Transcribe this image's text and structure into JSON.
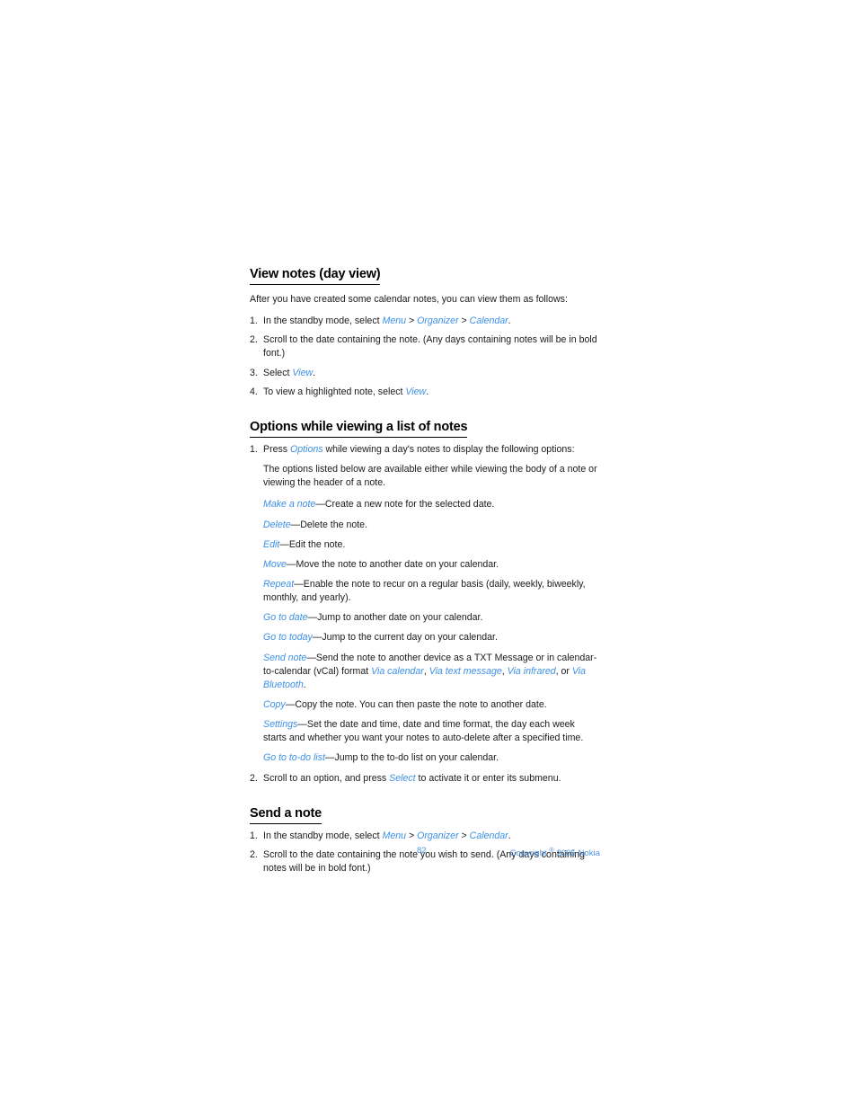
{
  "document": {
    "sections": [
      {
        "id": "view-notes",
        "heading": "View notes (day view)",
        "intro": "After you have created some calendar notes, you can view them as follows:",
        "steps": [
          {
            "num": "1.",
            "parts": [
              {
                "t": "text",
                "v": "In the standby mode, select "
              },
              {
                "t": "link",
                "v": "Menu"
              },
              {
                "t": "text",
                "v": " > "
              },
              {
                "t": "link",
                "v": "Organizer"
              },
              {
                "t": "text",
                "v": " > "
              },
              {
                "t": "link",
                "v": "Calendar"
              },
              {
                "t": "text",
                "v": "."
              }
            ]
          },
          {
            "num": "2.",
            "parts": [
              {
                "t": "text",
                "v": "Scroll to the date containing the note. (Any days containing notes will be in bold font.)"
              }
            ]
          },
          {
            "num": "3.",
            "parts": [
              {
                "t": "text",
                "v": "Select "
              },
              {
                "t": "link",
                "v": "View"
              },
              {
                "t": "text",
                "v": "."
              }
            ]
          },
          {
            "num": "4.",
            "parts": [
              {
                "t": "text",
                "v": "To view a highlighted note, select "
              },
              {
                "t": "link",
                "v": "View"
              },
              {
                "t": "text",
                "v": "."
              }
            ]
          }
        ]
      },
      {
        "id": "options-while-viewing",
        "heading": "Options while viewing a list of notes",
        "step1": {
          "num": "1.",
          "parts": [
            {
              "t": "text",
              "v": "Press "
            },
            {
              "t": "link",
              "v": "Options"
            },
            {
              "t": "text",
              "v": " while viewing a day's notes to display the following options:"
            }
          ]
        },
        "note_paragraph": "The options listed below are available either while viewing the body of a note or viewing the header of a note.",
        "options": [
          {
            "parts": [
              {
                "t": "link",
                "v": "Make a note"
              },
              {
                "t": "text",
                "v": "—Create a new note for the selected date."
              }
            ]
          },
          {
            "parts": [
              {
                "t": "link",
                "v": "Delete"
              },
              {
                "t": "text",
                "v": "—Delete the note."
              }
            ]
          },
          {
            "parts": [
              {
                "t": "link",
                "v": "Edit"
              },
              {
                "t": "text",
                "v": "—Edit the note."
              }
            ]
          },
          {
            "parts": [
              {
                "t": "link",
                "v": "Move"
              },
              {
                "t": "text",
                "v": "—Move the note to another date on your calendar."
              }
            ]
          },
          {
            "parts": [
              {
                "t": "link",
                "v": "Repeat"
              },
              {
                "t": "text",
                "v": "—Enable the note to recur on a regular basis (daily, weekly, biweekly, monthly, and yearly)."
              }
            ]
          },
          {
            "parts": [
              {
                "t": "link",
                "v": "Go to date"
              },
              {
                "t": "text",
                "v": "—Jump to another date on your calendar."
              }
            ]
          },
          {
            "parts": [
              {
                "t": "link",
                "v": "Go to today"
              },
              {
                "t": "text",
                "v": "—Jump to the current day on your calendar."
              }
            ]
          },
          {
            "parts": [
              {
                "t": "link",
                "v": "Send note"
              },
              {
                "t": "text",
                "v": "—Send the note to another device as a TXT Message or in calendar-to-calendar (vCal) format "
              },
              {
                "t": "link",
                "v": "Via calendar"
              },
              {
                "t": "text",
                "v": ", "
              },
              {
                "t": "link",
                "v": "Via text message"
              },
              {
                "t": "text",
                "v": ", "
              },
              {
                "t": "link",
                "v": "Via infrared"
              },
              {
                "t": "text",
                "v": ", or "
              },
              {
                "t": "link",
                "v": "Via Bluetooth"
              },
              {
                "t": "text",
                "v": "."
              }
            ]
          },
          {
            "parts": [
              {
                "t": "link",
                "v": "Copy"
              },
              {
                "t": "text",
                "v": "—Copy the note. You can then paste the note to another date."
              }
            ]
          },
          {
            "parts": [
              {
                "t": "link",
                "v": "Settings"
              },
              {
                "t": "text",
                "v": "—Set the date and time, date and time format, the day each week starts and whether you want your notes to auto-delete after a specified time."
              }
            ]
          },
          {
            "parts": [
              {
                "t": "link",
                "v": "Go to to-do list"
              },
              {
                "t": "text",
                "v": "—Jump to the to-do list on your calendar."
              }
            ]
          }
        ],
        "step2": {
          "num": "2.",
          "parts": [
            {
              "t": "text",
              "v": "Scroll to an option, and press "
            },
            {
              "t": "link",
              "v": "Select"
            },
            {
              "t": "text",
              "v": " to activate it or enter its submenu."
            }
          ]
        }
      },
      {
        "id": "send-a-note",
        "heading": "Send a note",
        "steps": [
          {
            "num": "1.",
            "parts": [
              {
                "t": "text",
                "v": "In the standby mode, select "
              },
              {
                "t": "link",
                "v": "Menu"
              },
              {
                "t": "text",
                "v": " > "
              },
              {
                "t": "link",
                "v": "Organizer"
              },
              {
                "t": "text",
                "v": " > "
              },
              {
                "t": "link",
                "v": "Calendar"
              },
              {
                "t": "text",
                "v": "."
              }
            ]
          },
          {
            "num": "2.",
            "parts": [
              {
                "t": "text",
                "v": "Scroll to the date containing the note you wish to send. (Any days containing notes will be in bold font.)"
              }
            ]
          }
        ]
      }
    ]
  },
  "footer": {
    "page_number": "82",
    "copyright_prefix": "Copyright ",
    "copyright_symbol": "®",
    "copyright_suffix": " 2005 Nokia"
  },
  "colors": {
    "link_blue": "#3d8fe8",
    "footer_blue": "#4f94e0",
    "body_text": "#1a1a1a",
    "heading": "#000000",
    "background": "#ffffff"
  }
}
